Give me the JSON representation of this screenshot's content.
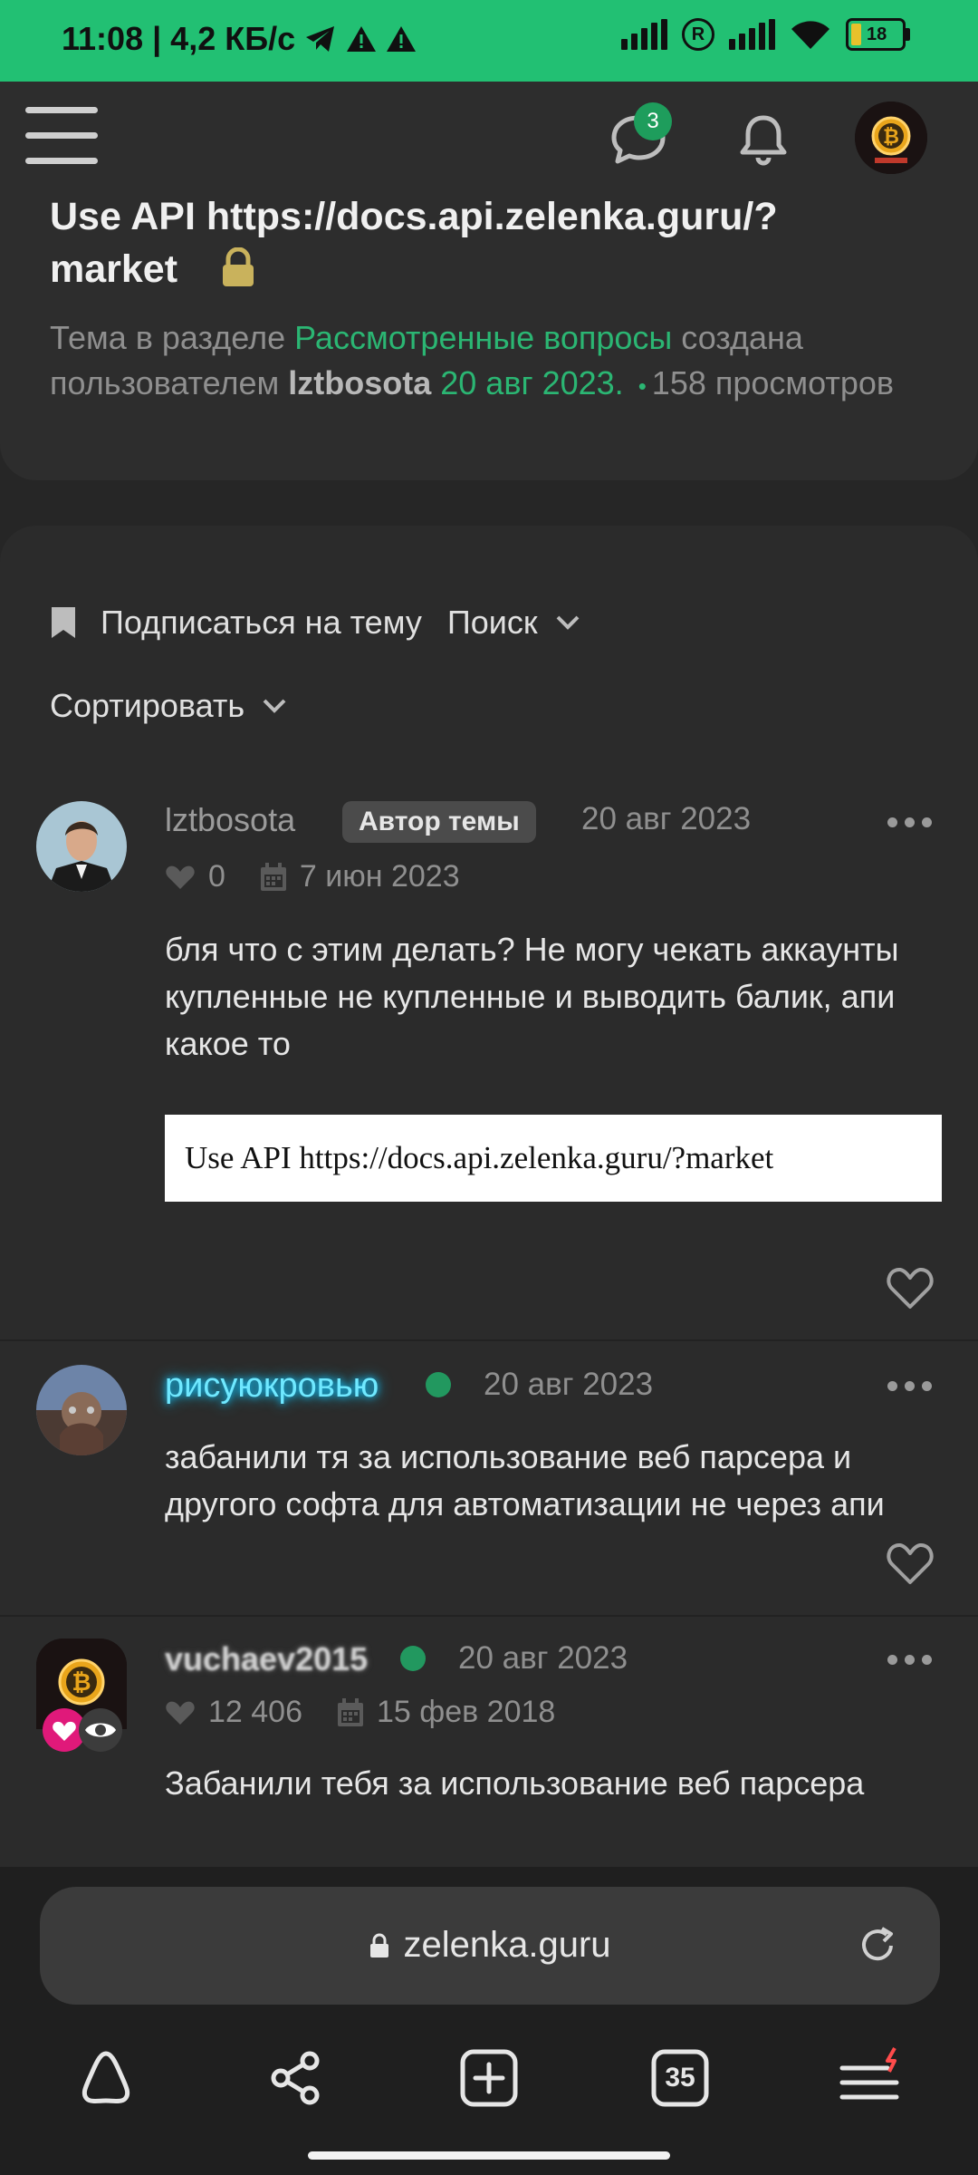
{
  "status_bar": {
    "time": "11:08",
    "separator": "|",
    "speed": "4,2 КБ/с",
    "battery": "18"
  },
  "header": {
    "messages_badge": "3"
  },
  "topic": {
    "title": "Use API https://docs.api.zelenka.guru/?market",
    "meta_prefix": "Тема в разделе ",
    "section": "Рассмотренные вопросы",
    "meta_created": " создана пользователем ",
    "author": "lztbosota",
    "date": " 20 авг 2023.",
    "views": "158 просмотров"
  },
  "toolbar": {
    "subscribe": "Подписаться на тему",
    "search": "Поиск",
    "sort": "Сортировать"
  },
  "posts": [
    {
      "username": "lztbosota",
      "badge": "Автор темы",
      "date": "20 авг 2023",
      "likes": "0",
      "registered": "7 июн 2023",
      "text": "бля что с этим делать? Не могу чекать аккаунты купленные не купленные и выводить балик, апи какое то",
      "image_text": "Use API https://docs.api.zelenka.guru/?market"
    },
    {
      "username": "рисуюкровью",
      "date": "20 авг 2023",
      "text": "забанили тя за использование веб парсера и другого софта для автоматизации не через апи"
    },
    {
      "username": "vuchaev2015",
      "date": "20 авг 2023",
      "likes": "12 406",
      "registered": "15 фев 2018",
      "text": "Забанили тебя за использование веб парсера"
    }
  ],
  "browser": {
    "url": "zelenka.guru",
    "tabs_count": "35"
  },
  "colors": {
    "status_bar": "#22c073",
    "accent_green": "#2bb673",
    "background": "#262626"
  }
}
